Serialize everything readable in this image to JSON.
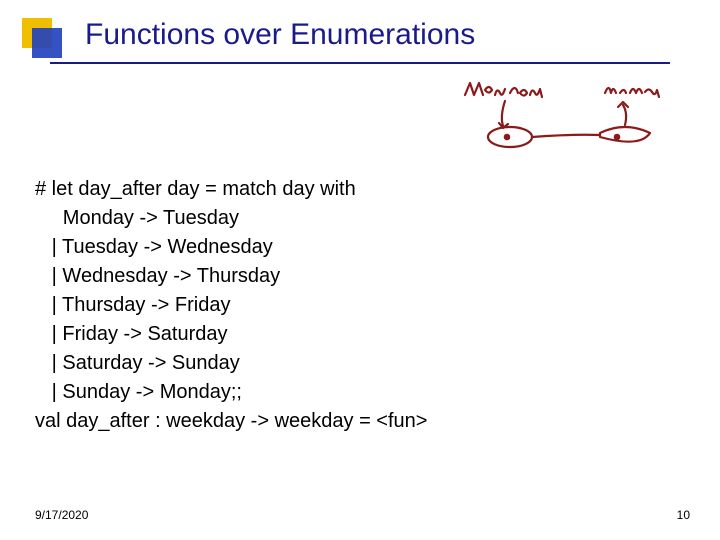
{
  "title": "Functions over Enumerations",
  "code": {
    "l0": "# let day_after day = match day with",
    "l1": "     Monday -> Tuesday",
    "l2": "   | Tuesday -> Wednesday",
    "l3": "   | Wednesday -> Thursday",
    "l4": "   | Thursday -> Friday",
    "l5": "   | Friday -> Saturday",
    "l6": "   | Saturday -> Sunday",
    "l7": "   | Sunday -> Monday;;",
    "l8": "val day_after : weekday -> weekday = <fun>"
  },
  "footer": {
    "date": "9/17/2020",
    "page": "10"
  }
}
